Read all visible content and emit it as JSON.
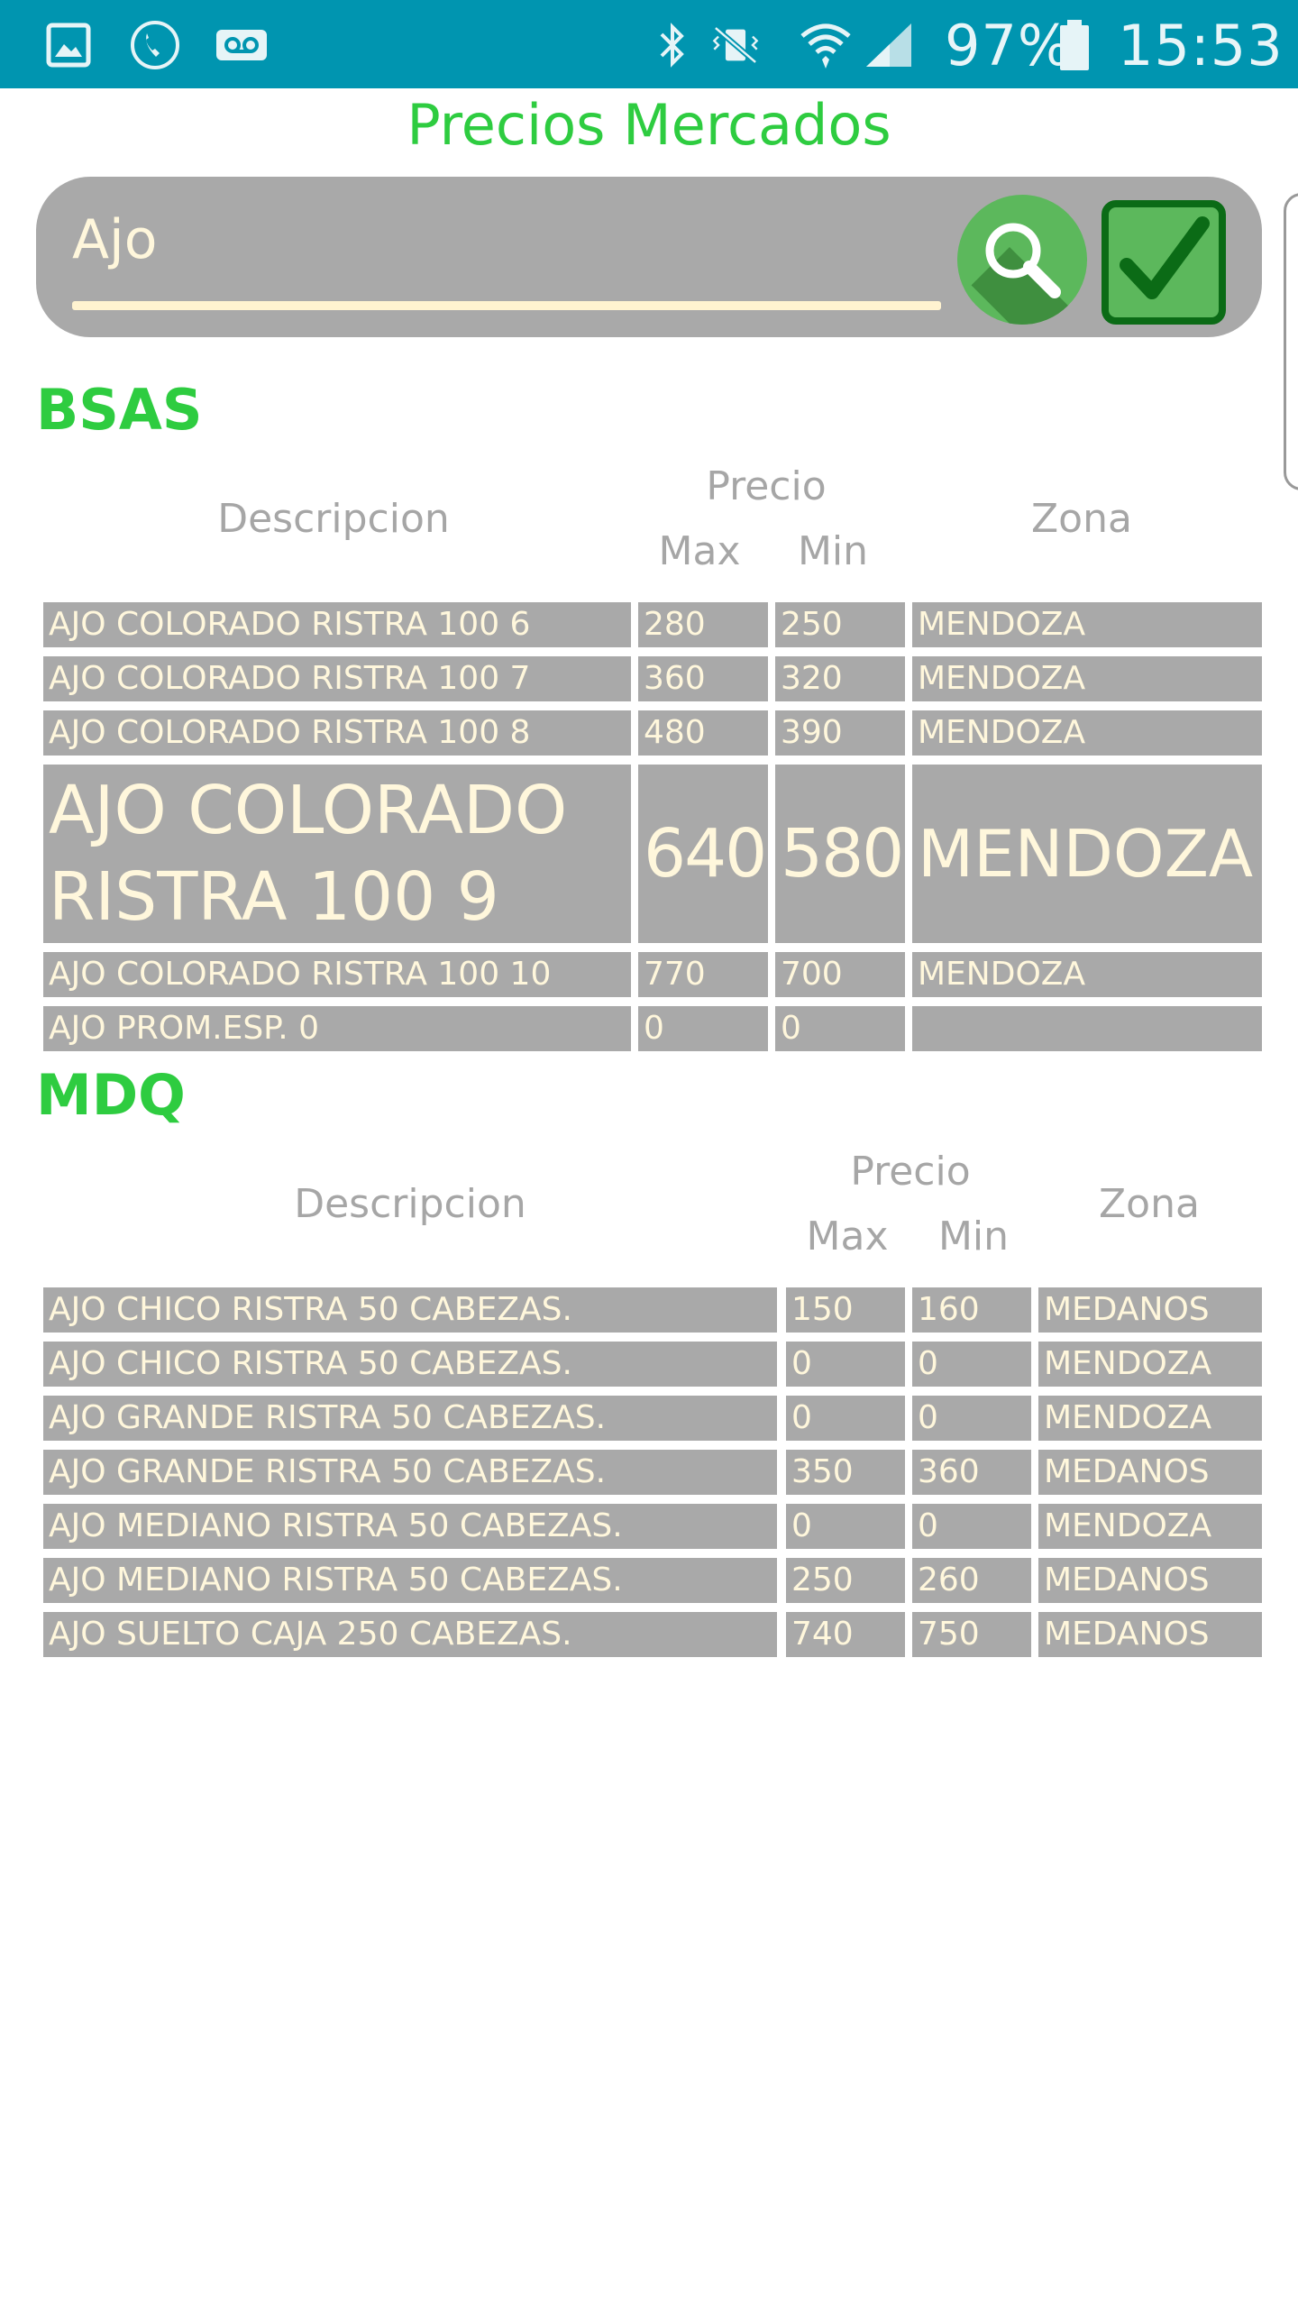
{
  "status_bar": {
    "battery": "97%",
    "time": "15:53",
    "icons": [
      "gallery-icon",
      "phone-call-icon",
      "voicemail-icon",
      "bluetooth-icon",
      "vibrate-mute-icon",
      "wifi-icon",
      "signal-icon",
      "battery-icon"
    ]
  },
  "title": "Precios Mercados",
  "search": {
    "value": "Ajo",
    "placeholder": "",
    "search_icon": "magnifier-icon",
    "confirm_icon": "checkmark-icon"
  },
  "header": {
    "descripcion": "Descripcion",
    "precio": "Precio",
    "max": "Max",
    "min": "Min",
    "zona": "Zona"
  },
  "sections": [
    {
      "name": "BSAS",
      "rows": [
        {
          "descripcion": "AJO COLORADO RISTRA 100 6",
          "max": "280",
          "min": "250",
          "zona": "MENDOZA"
        },
        {
          "descripcion": "AJO COLORADO RISTRA 100 7",
          "max": "360",
          "min": "320",
          "zona": "MENDOZA"
        },
        {
          "descripcion": "AJO COLORADO RISTRA 100 8",
          "max": "480",
          "min": "390",
          "zona": "MENDOZA"
        },
        {
          "descripcion": "AJO COLORADO RISTRA 100 9",
          "max": "640",
          "min": "580",
          "zona": "MENDOZA"
        },
        {
          "descripcion": "AJO COLORADO RISTRA 100 10",
          "max": "770",
          "min": "700",
          "zona": "MENDOZA"
        },
        {
          "descripcion": "AJO PROM.ESP. 0",
          "max": "0",
          "min": "0",
          "zona": ""
        }
      ]
    },
    {
      "name": "MDQ",
      "rows": [
        {
          "descripcion": "AJO CHICO RISTRA 50 CABEZAS.",
          "max": "150",
          "min": "160",
          "zona": "MEDANOS"
        },
        {
          "descripcion": "AJO CHICO RISTRA 50 CABEZAS.",
          "max": "0",
          "min": "0",
          "zona": "MENDOZA"
        },
        {
          "descripcion": "AJO GRANDE RISTRA 50 CABEZAS.",
          "max": "0",
          "min": "0",
          "zona": "MENDOZA"
        },
        {
          "descripcion": "AJO GRANDE RISTRA 50 CABEZAS.",
          "max": "350",
          "min": "360",
          "zona": "MEDANOS"
        },
        {
          "descripcion": "AJO MEDIANO RISTRA 50 CABEZAS.",
          "max": "0",
          "min": "0",
          "zona": "MENDOZA"
        },
        {
          "descripcion": "AJO MEDIANO RISTRA 50 CABEZAS.",
          "max": "250",
          "min": "260",
          "zona": "MEDANOS"
        },
        {
          "descripcion": "AJO SUELTO CAJA 250 CABEZAS.",
          "max": "740",
          "min": "750",
          "zona": "MEDANOS"
        }
      ]
    }
  ]
}
